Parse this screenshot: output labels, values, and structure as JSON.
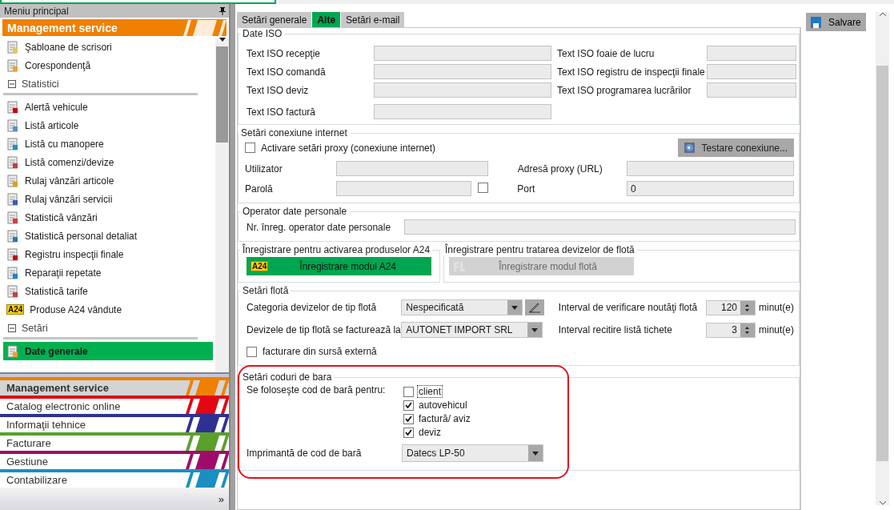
{
  "sidebar": {
    "title": "Meniu principal",
    "module": "Management service",
    "items": [
      {
        "kind": "item",
        "label": "Şabloane de scrisori",
        "selected": false
      },
      {
        "kind": "item",
        "label": "Corespondenţă",
        "selected": false
      },
      {
        "kind": "section",
        "label": "Statistici",
        "expanded": true
      },
      {
        "kind": "item",
        "label": "Alertă vehicule",
        "selected": false
      },
      {
        "kind": "item",
        "label": "Listă articole",
        "selected": false
      },
      {
        "kind": "item",
        "label": "Listă cu manopere",
        "selected": false
      },
      {
        "kind": "item",
        "label": "Listă comenzi/devize",
        "selected": false
      },
      {
        "kind": "item",
        "label": "Rulaj vânzări articole",
        "selected": false
      },
      {
        "kind": "item",
        "label": "Rulaj vânzări servicii",
        "selected": false
      },
      {
        "kind": "item",
        "label": "Statistică vânzări",
        "selected": false
      },
      {
        "kind": "item",
        "label": "Statistică personal detaliat",
        "selected": false
      },
      {
        "kind": "item",
        "label": "Registru inspecţii finale",
        "selected": false
      },
      {
        "kind": "item",
        "label": "Reparaţii repetate",
        "selected": false
      },
      {
        "kind": "item",
        "label": "Statistică tarife",
        "selected": false
      },
      {
        "kind": "item",
        "label": "Produse A24 vândute",
        "selected": false,
        "badge": "A24"
      },
      {
        "kind": "section",
        "label": "Setări",
        "expanded": true
      },
      {
        "kind": "item",
        "label": "Date generale",
        "selected": true
      }
    ],
    "categories": [
      {
        "label": "Management service",
        "color": "#f08000",
        "selected": true
      },
      {
        "label": "Catalog electronic online",
        "color": "#e30613",
        "selected": false
      },
      {
        "label": "Informaţii tehnice",
        "color": "#2e3192",
        "selected": false
      },
      {
        "label": "Facturare",
        "color": "#5aa02c",
        "selected": false
      },
      {
        "label": "Gestiune",
        "color": "#9e0b6b",
        "selected": false
      },
      {
        "label": "Contabilizare",
        "color": "#1a8fc0",
        "selected": false
      }
    ],
    "more": "»"
  },
  "tabs": [
    {
      "label": "Setări generale",
      "selected": false
    },
    {
      "label": "Alte",
      "selected": true
    },
    {
      "label": "Setări e-mail",
      "selected": false
    }
  ],
  "iso": {
    "title": "Date ISO",
    "left": [
      "Text ISO recepţie",
      "Text ISO comandă",
      "Text ISO deviz",
      "Text ISO factură"
    ],
    "right": [
      "Text ISO foaie de lucru",
      "Text ISO registru de inspecţii finale",
      "Text ISO programarea lucrărilor"
    ]
  },
  "internet": {
    "title": "Setări conexiune internet",
    "proxy": {
      "label": "Activare setări proxy (conexiune internet)",
      "checked": false
    },
    "test_button": "Testare conexiune...",
    "user_label": "Utilizator",
    "proxy_url_label": "Adresă proxy (URL)",
    "password_label": "Parolă",
    "show_password": {
      "checked": false
    },
    "port_label": "Port",
    "port_value": "0"
  },
  "operator": {
    "title": "Operator date personale",
    "label": "Nr. înreg. operator date personale"
  },
  "a24": {
    "title": "Înregistrare pentru activarea produselor A24",
    "badge": "A24",
    "button": "Înregistrare modul A24",
    "disabled": false
  },
  "fleet_reg": {
    "title": "Înregistrare pentru tratarea devizelor de flotă",
    "button": "Înregistrare modul flotă",
    "disabled": true
  },
  "fleet": {
    "title": "Setări flotă",
    "category_label": "Categoria devizelor de tip flotă",
    "category_value": "Nespecificată",
    "billed_label": "Devizele de tip flotă se facturează la",
    "billed_value": "AUTONET IMPORT SRL",
    "external": {
      "label": "facturare din sursă externă",
      "checked": false
    },
    "intervals": [
      {
        "label": "Interval de verificare noutăţi flotă",
        "value": "120",
        "unit": "minut(e)"
      },
      {
        "label": "Interval recitire listă tichete",
        "value": "3",
        "unit": "minut(e)"
      }
    ]
  },
  "barcode": {
    "title": "Setări coduri de bara",
    "highlighted": true,
    "use_label": "Se foloseşte cod de bară pentru:",
    "options": [
      {
        "label": "client",
        "checked": false,
        "focused": true
      },
      {
        "label": "autovehicul",
        "checked": true,
        "focused": false
      },
      {
        "label": "factură/ aviz",
        "checked": true,
        "focused": false
      },
      {
        "label": "deviz",
        "checked": true,
        "focused": false
      }
    ],
    "printer_label": "Imprimantă de cod de bară",
    "printer_value": "Datecs LP-50"
  },
  "save_button": "Salvare"
}
